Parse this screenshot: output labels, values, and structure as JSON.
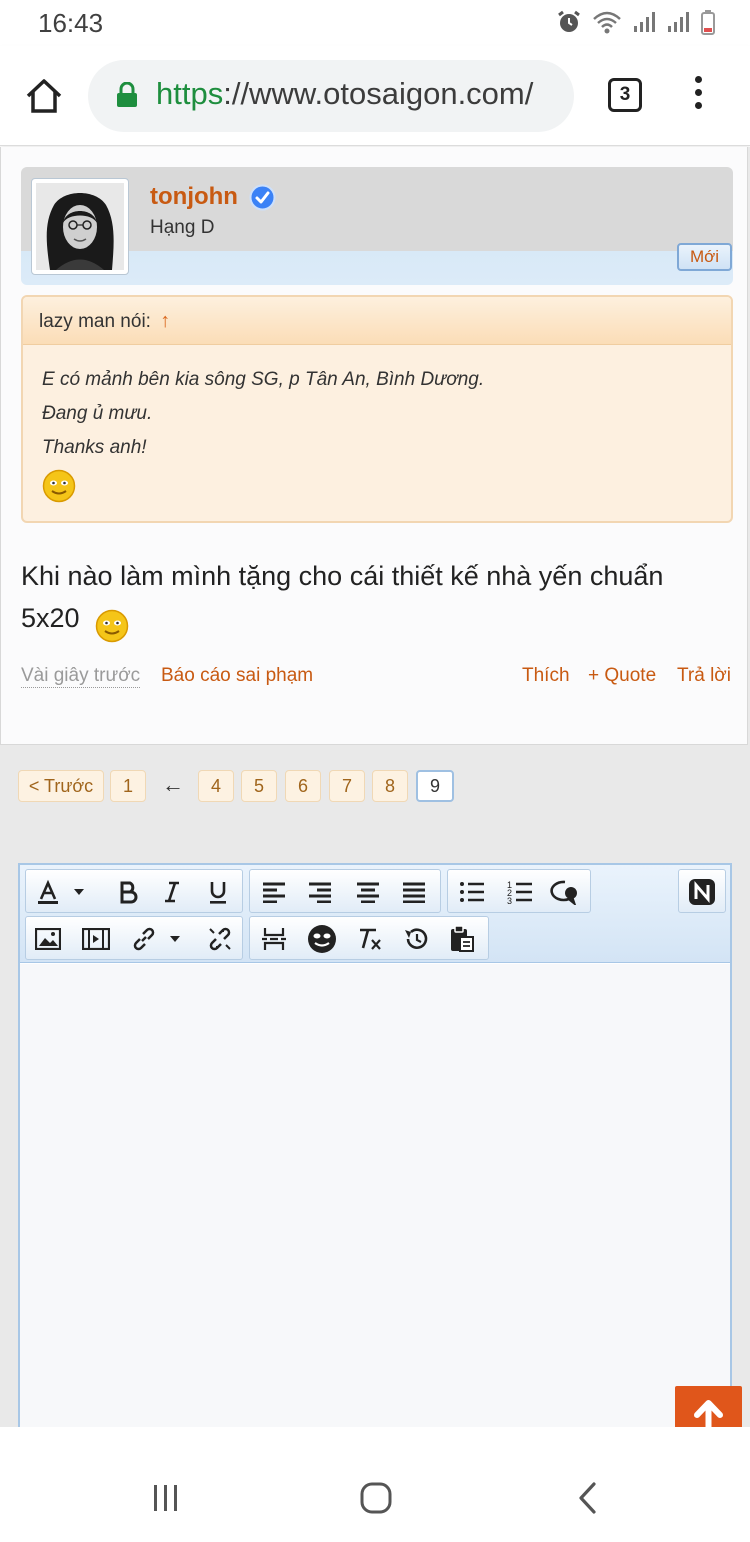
{
  "status_bar": {
    "time": "16:43"
  },
  "browser": {
    "url_scheme": "https",
    "url_rest": "://www.otosaigon.com/",
    "tab_count": "3"
  },
  "post": {
    "username": "tonjohn",
    "rank": "Hạng D",
    "new_badge": "Mới",
    "quote": {
      "author": "lazy man nói:",
      "arrow": "↑",
      "lines": [
        "E có mảnh bên kia sông SG, p Tân An, Bình Dương.",
        "Đang ủ mưu.",
        "Thanks anh!"
      ]
    },
    "text_line1": "Khi nào làm mình tặng cho cái thiết kế nhà yến chuẩn",
    "text_line2": "5x20",
    "footer": {
      "time": "Vài giây trước",
      "report": "Báo cáo sai phạm",
      "like": "Thích",
      "quote": "+ Quote",
      "reply": "Trả lời"
    }
  },
  "pagination": {
    "prev": "< Trước",
    "first": "1",
    "ellipsis_arrow": "←",
    "pages": [
      "4",
      "5",
      "6",
      "7",
      "8",
      "9"
    ],
    "current": "9"
  },
  "editor": {
    "toolbar_row1": [
      "text-color-icon",
      "dropdown-icon",
      "bold-icon",
      "italic-icon",
      "underline-icon",
      "align-left-icon",
      "align-center-icon",
      "align-right-icon",
      "justify-icon",
      "bullet-list-icon",
      "numbered-list-icon",
      "quote-bubble-icon",
      "toggle-source-icon"
    ],
    "toolbar_row2": [
      "image-icon",
      "media-icon",
      "link-icon",
      "dropdown-icon",
      "unlink-icon",
      "page-break-icon",
      "smilie-icon",
      "remove-format-icon",
      "undo-icon",
      "paste-icon"
    ],
    "content": ""
  },
  "colors": {
    "accent_orange": "#c85a12",
    "link_blue": "#1e8e3e",
    "scroll_top": "#e0561b"
  }
}
